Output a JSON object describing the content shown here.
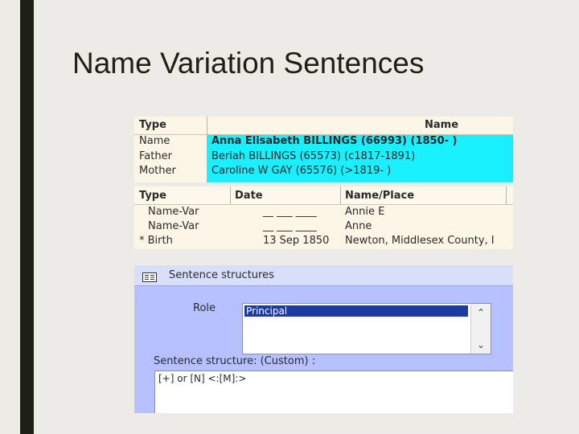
{
  "slide": {
    "title": "Name Variation Sentences"
  },
  "names_table": {
    "headers": {
      "type": "Type",
      "name": "Name"
    },
    "rows": [
      {
        "type": "Name",
        "name": "Anna Elisabeth BILLINGS (66993)  (1850-    )"
      },
      {
        "type": "Father",
        "name": "Beriah BILLINGS (65573)  (c1817-1891)"
      },
      {
        "type": "Mother",
        "name": "Caroline W GAY (65576)  (>1819-    )"
      }
    ],
    "highlight_color": "#19f0ff"
  },
  "events_table": {
    "headers": {
      "type": "Type",
      "date": "Date",
      "name_place": "Name/Place"
    },
    "rows": [
      {
        "type": "Name-Var",
        "date": "__ ___ ____",
        "name_place": "Annie E"
      },
      {
        "type": "Name-Var",
        "date": "__ ___ ____",
        "name_place": "Anne"
      },
      {
        "type": "* Birth",
        "date": "13 Sep 1850",
        "name_place": "Newton, Middlesex County, I"
      }
    ]
  },
  "sentence_panel": {
    "title": "Sentence structures",
    "role_label": "Role",
    "role_value": "Principal",
    "structure_label": "Sentence structure: (Custom) :",
    "structure_text": "[+] or [N] <:[M]:>",
    "panel_color": "#b7c1ff"
  }
}
